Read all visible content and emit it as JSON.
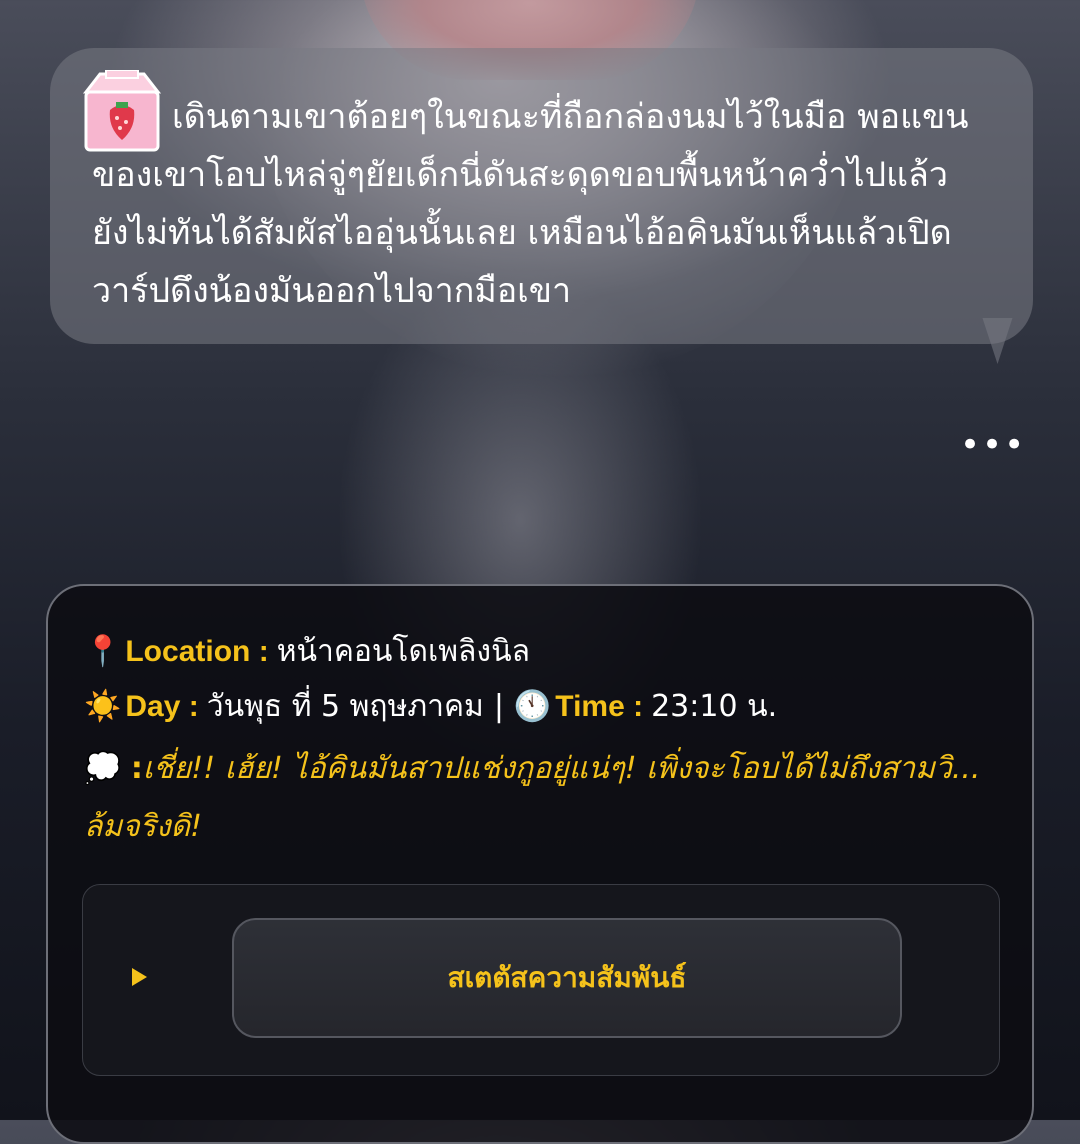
{
  "message": {
    "text": "เดินตามเขาต้อยๆในขณะที่ถือกล่องนมไว้ในมือ พอแขนของเขาโอบไหล่จู่ๆยัยเด็กนี่ดันสะดุดขอบพื้นหน้าคว่ำไปแล้ว ยังไม่ทันได้สัมผัสไออุ่นนั้นเลย เหมือนไอ้อคินมันเห็นแล้วเปิดวาร์ปดึงน้องมันออกไปจากมือเขา",
    "icon": "strawberry-milk-carton-icon"
  },
  "more_label": "•••",
  "info": {
    "location_emoji": "📍",
    "location_label": "Location :",
    "location_value": "หน้าคอนโดเพลิงนิล",
    "day_emoji": "☀️",
    "day_label": "Day :",
    "day_value": "วันพุธ ที่ 5 พฤษภาคม",
    "separator": "|",
    "time_emoji": "🕚",
    "time_label": "Time :",
    "time_value": "23:10 น.",
    "thought_emoji": "💭",
    "thought_colon": ":",
    "thought_text": "เชี่ย!! เฮ้ย! ไอ้คินมันสาปแช่งกูอยู่แน่ๆ! เพิ่งจะโอบได้ไม่ถึงสามวิ... ล้มจริงดิ!"
  },
  "status": {
    "button_label": "สเตตัสความสัมพันธ์"
  },
  "colors": {
    "accent": "#f5c21b",
    "card_bg": "#0c0d12",
    "bubble_bg": "#787a84"
  }
}
